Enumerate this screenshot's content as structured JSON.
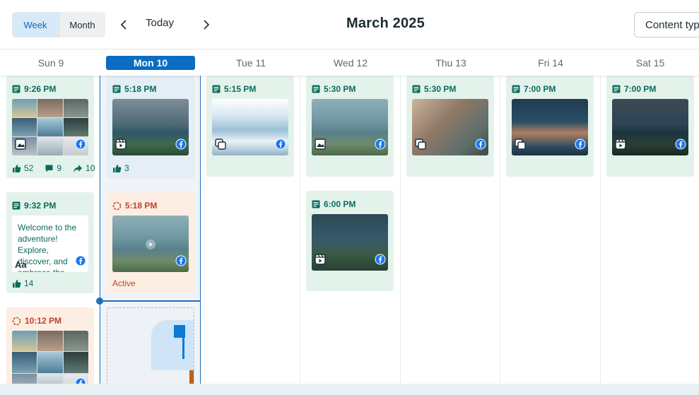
{
  "toolbar": {
    "week_label": "Week",
    "month_label": "Month",
    "today_label": "Today",
    "title": "March 2025",
    "content_filter_label": "Content type"
  },
  "days": [
    {
      "label": "Sun 9",
      "current": false
    },
    {
      "label": "Mon 10",
      "current": true
    },
    {
      "label": "Tue 11",
      "current": false
    },
    {
      "label": "Wed 12",
      "current": false
    },
    {
      "label": "Thu 13",
      "current": false
    },
    {
      "label": "Fri 14",
      "current": false
    },
    {
      "label": "Sat 15",
      "current": false
    }
  ],
  "posts": {
    "sun_1": {
      "time": "9:26 PM",
      "likes": "52",
      "comments": "9",
      "shares": "10",
      "media": "photo-album",
      "platform": "facebook"
    },
    "sun_2": {
      "time": "9:32 PM",
      "text": "Welcome to the adventure! Explore, discover, and embrace the thrill of the…",
      "likes": "14",
      "media": "text",
      "platform": "facebook"
    },
    "sun_3": {
      "time": "10:12 PM",
      "status": "pending",
      "media": "photo-album",
      "platform": "facebook"
    },
    "mon_1": {
      "time": "5:18 PM",
      "likes": "3",
      "media": "reel",
      "platform": "facebook"
    },
    "mon_2": {
      "time": "5:18 PM",
      "status": "Active",
      "media": "video",
      "platform": "facebook"
    },
    "tue_1": {
      "time": "5:15 PM",
      "media": "carousel",
      "platform": "facebook"
    },
    "wed_1": {
      "time": "5:30 PM",
      "media": "photo",
      "platform": "facebook"
    },
    "wed_2": {
      "time": "6:00 PM",
      "media": "reel",
      "platform": "facebook"
    },
    "thu_1": {
      "time": "5:30 PM",
      "media": "carousel",
      "platform": "facebook"
    },
    "fri_1": {
      "time": "7:00 PM",
      "media": "carousel",
      "platform": "facebook"
    },
    "sat_1": {
      "time": "7:00 PM",
      "media": "reel",
      "platform": "facebook"
    }
  },
  "colors": {
    "accent": "#0a6cc2",
    "published_card": "#e3f3ec",
    "pending_card": "#fdeee3",
    "published_text": "#0b6b5a",
    "pending_text": "#c3402a",
    "facebook": "#1877f2"
  }
}
